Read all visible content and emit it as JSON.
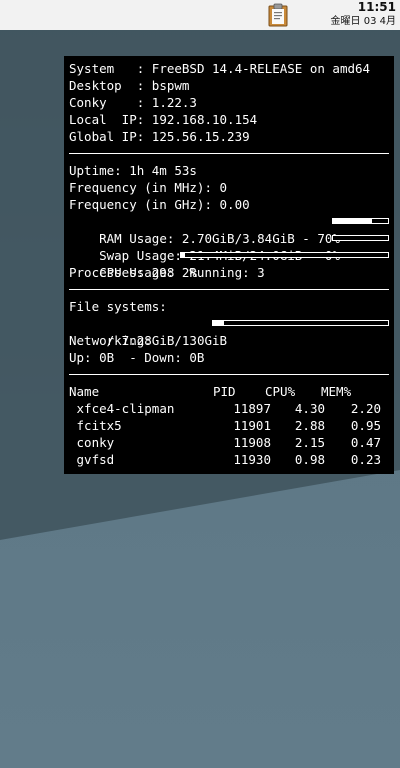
{
  "topbar": {
    "tray_icon": "clipboard-icon",
    "clock_time": "11:51",
    "clock_date": "金曜日 03 4月"
  },
  "conky": {
    "system": [
      {
        "label": "System   ",
        "value": "FreeBSD 14.4-RELEASE on amd64"
      },
      {
        "label": "Desktop  ",
        "value": "bspwm"
      },
      {
        "label": "Conky    ",
        "value": "1.22.3"
      },
      {
        "label": "Local  IP",
        "value": "192.168.10.154"
      },
      {
        "label": "Global IP",
        "value": "125.56.15.239"
      }
    ],
    "uptime": "Uptime: 1h 4m 53s",
    "freq_mhz": "Frequency (in MHz): 0",
    "freq_ghz": "Frequency (in GHz): 0.00",
    "ram": {
      "text": "RAM Usage: 2.70GiB/3.84GiB - 70%",
      "percent": 70
    },
    "swap": {
      "text": "Swap Usage: 21.4MiB/24.0GiB - 0%",
      "percent": 0
    },
    "cpu": {
      "text": "CPU Usage: 2%",
      "percent": 2
    },
    "processes": "Processes: 298  Running: 3",
    "fs_title": "File systems:",
    "fs_root": {
      "text": " / 7.28GiB/130GiB",
      "percent": 6
    },
    "net_title": "Networking:",
    "net": "Up: 0B  - Down: 0B",
    "proc_headers": {
      "name": "Name",
      "pid": "PID",
      "cpu": "CPU%",
      "mem": "MEM%"
    },
    "processes_list": [
      {
        "name": "xfce4-clipman",
        "pid": "11897",
        "cpu": "4.30",
        "mem": "2.20"
      },
      {
        "name": "fcitx5",
        "pid": "11901",
        "cpu": "2.88",
        "mem": "0.95"
      },
      {
        "name": "conky",
        "pid": "11908",
        "cpu": "2.15",
        "mem": "0.47"
      },
      {
        "name": "gvfsd",
        "pid": "11930",
        "cpu": "0.98",
        "mem": "0.23"
      }
    ]
  }
}
